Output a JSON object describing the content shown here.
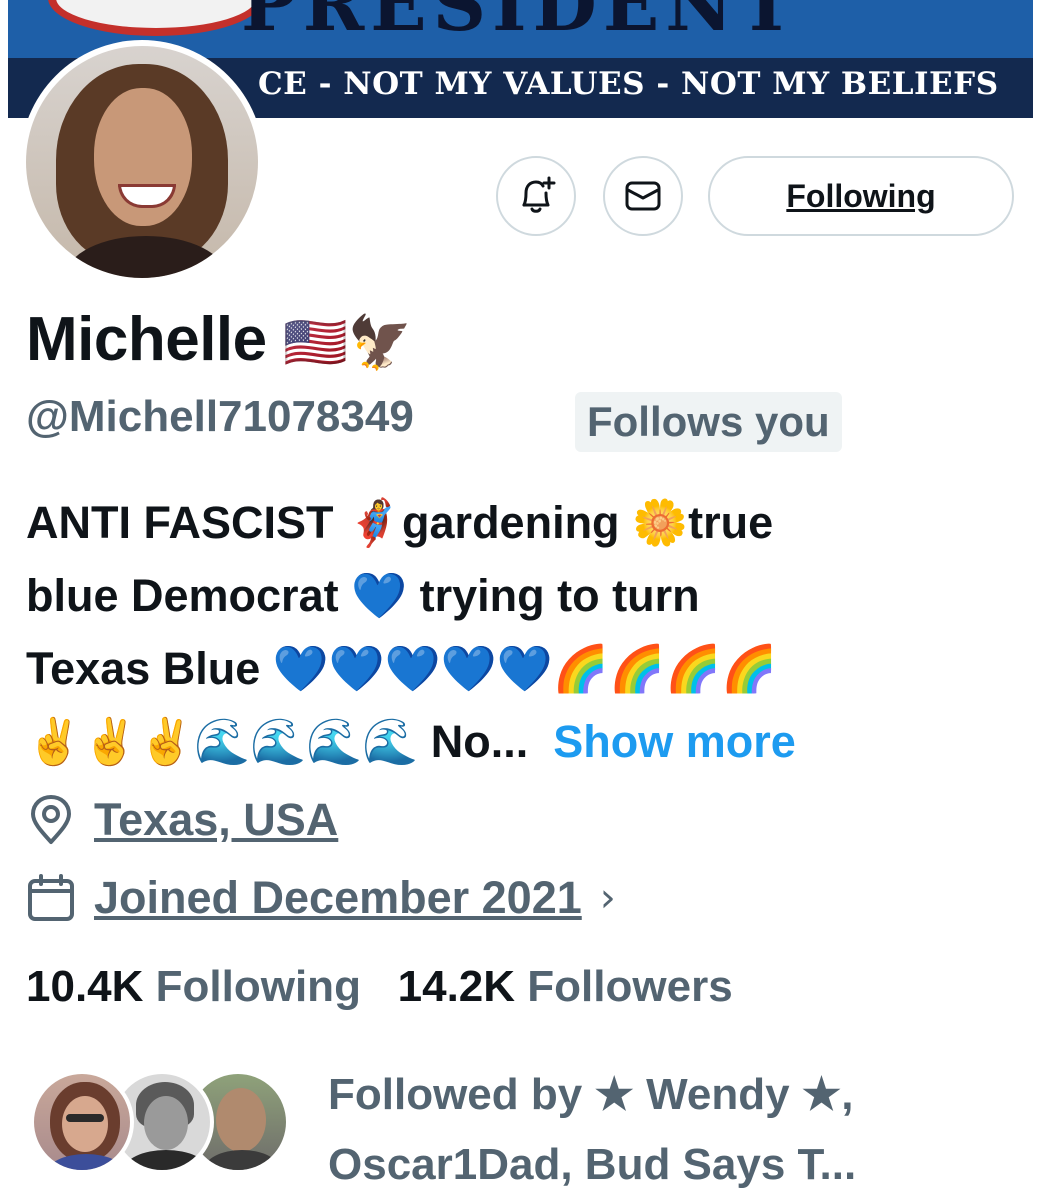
{
  "banner": {
    "headline": "PRESIDENT",
    "tagline": "CE - NOT MY VALUES - NOT MY BELIEFS"
  },
  "actions": {
    "notify_icon": "bell-plus-icon",
    "message_icon": "envelope-icon",
    "follow_label": "Following"
  },
  "profile": {
    "display_name": "Michelle",
    "name_emoji": "🇺🇸🦅",
    "handle": "@Michell71078349",
    "follows_you": "Follows you",
    "bio_lines": [
      "ANTI FASCIST 🦸‍♀️gardening 🌼true",
      "blue Democrat 💙 trying to turn",
      "Texas Blue 💙💙💙💙💙🌈🌈🌈🌈",
      "✌️✌️✌️🌊🌊🌊🌊 No..."
    ],
    "show_more": "Show more",
    "location": "Texas, USA",
    "joined": "Joined December 2021"
  },
  "stats": {
    "following_count": "10.4K",
    "following_label": "Following",
    "followers_count": "14.2K",
    "followers_label": "Followers"
  },
  "followed_by": {
    "line1": "Followed by ★ Wendy ★,",
    "line2": "Oscar1Dad, Bud Says T..."
  },
  "colors": {
    "text_primary": "#0f1419",
    "text_secondary": "#536471",
    "link": "#1d9bf0",
    "border": "#cfd9de",
    "badge_bg": "#eff3f4"
  }
}
